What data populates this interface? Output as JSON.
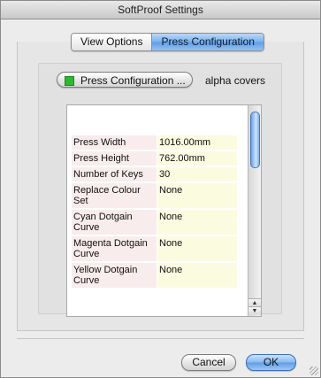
{
  "window": {
    "title": "SoftProof Settings"
  },
  "tabs": [
    {
      "label": "View Options",
      "active": false
    },
    {
      "label": "Press Configuration",
      "active": true
    }
  ],
  "press_button": {
    "label": "Press Configuration ...",
    "indicator_color": "#2eb82e"
  },
  "alpha_label": "alpha covers",
  "properties": [
    {
      "key": "Press Width",
      "value": "1016.00mm"
    },
    {
      "key": "Press Height",
      "value": "762.00mm"
    },
    {
      "key": "Number of Keys",
      "value": "30"
    },
    {
      "key": "Replace Colour Set",
      "value": "None"
    },
    {
      "key": "Cyan Dotgain Curve",
      "value": "None"
    },
    {
      "key": "Magenta Dotgain Curve",
      "value": "None"
    },
    {
      "key": "Yellow Dotgain Curve",
      "value": "None"
    }
  ],
  "buttons": {
    "cancel": "Cancel",
    "ok": "OK"
  },
  "colors": {
    "accent": "#5f9ee6",
    "key_cell": "#f9ecec",
    "value_cell": "#fbfbe0"
  }
}
